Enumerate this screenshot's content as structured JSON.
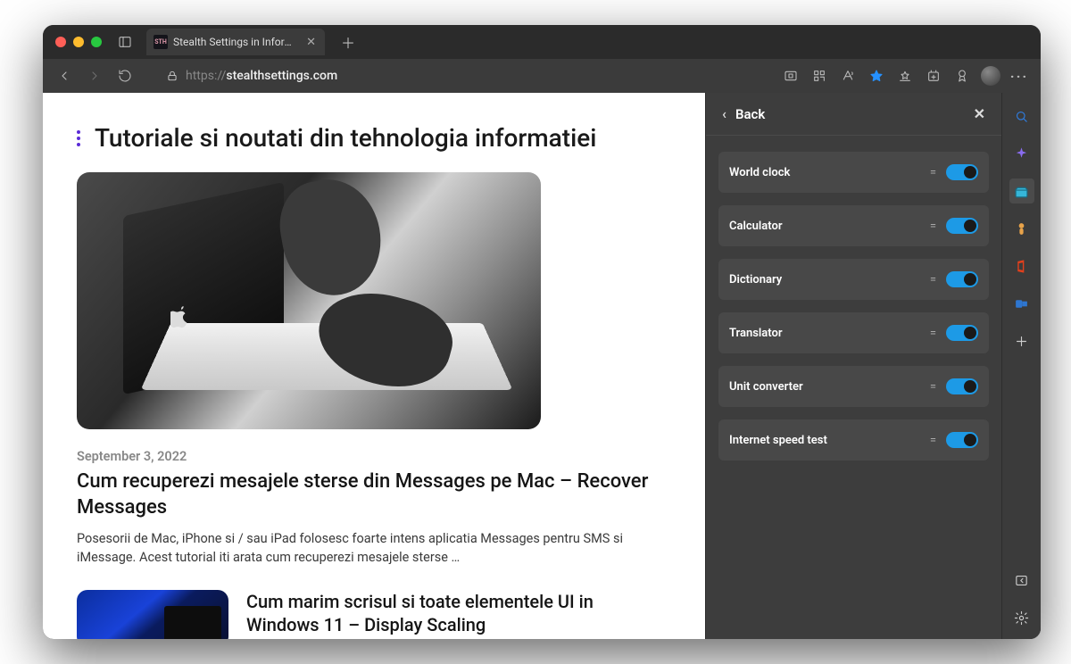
{
  "tab": {
    "favicon_text": "STH",
    "title": "Stealth Settings in Information"
  },
  "url": {
    "scheme": "https://",
    "host": "stealthsettings.com"
  },
  "page": {
    "heading": "Tutoriale si noutati din tehnologia informatiei",
    "article1": {
      "date": "September 3, 2022",
      "title": "Cum recuperezi mesajele sterse din Messages pe Mac – Recover Messages",
      "excerpt": "Posesorii de Mac, iPhone si / sau iPad folosesc foarte intens aplicatia Messages pentru SMS si iMessage. Acest tutorial iti arata cum recuperezi mesajele sterse …"
    },
    "article2": {
      "title": "Cum marim scrisul si toate elementele UI in Windows 11 – Display Scaling"
    }
  },
  "panel": {
    "back_label": "Back",
    "tools": [
      {
        "label": "World clock",
        "enabled": true
      },
      {
        "label": "Calculator",
        "enabled": true
      },
      {
        "label": "Dictionary",
        "enabled": true
      },
      {
        "label": "Translator",
        "enabled": true
      },
      {
        "label": "Unit converter",
        "enabled": true
      },
      {
        "label": "Internet speed test",
        "enabled": true
      }
    ]
  }
}
